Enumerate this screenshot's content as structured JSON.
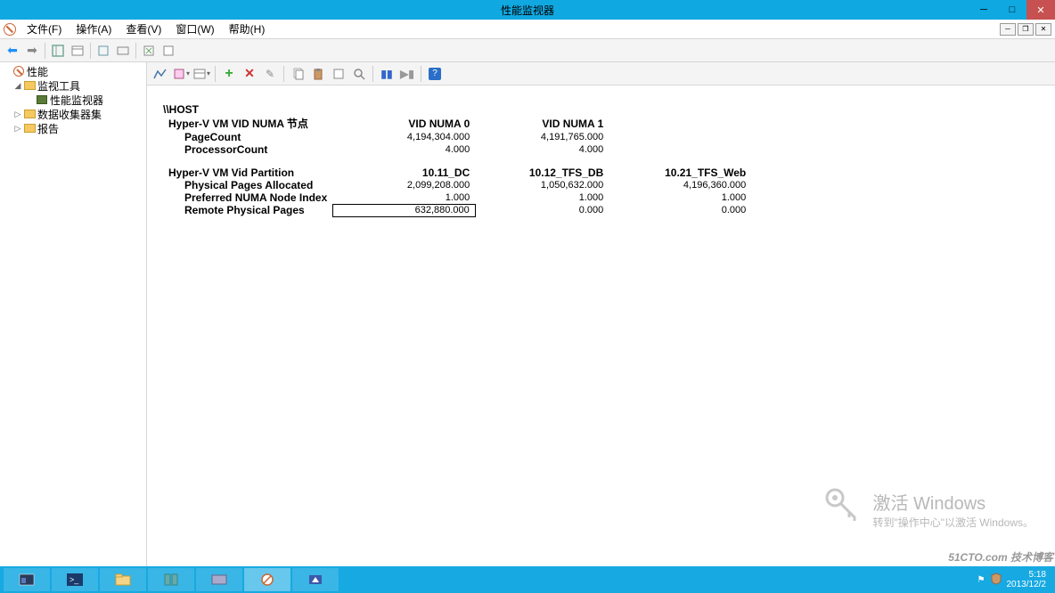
{
  "titlebar": {
    "title": "性能监视器"
  },
  "menus": {
    "file": "文件(F)",
    "action": "操作(A)",
    "view": "查看(V)",
    "window": "窗口(W)",
    "help": "帮助(H)"
  },
  "tree": {
    "root": "性能",
    "monitor_tools": "监视工具",
    "perf_monitor": "性能监视器",
    "collector_sets": "数据收集器集",
    "reports": "报告"
  },
  "report": {
    "host": "\\\\HOST",
    "group1": {
      "label": "Hyper-V VM VID NUMA 节点",
      "cols": [
        "VID NUMA 0",
        "VID NUMA 1"
      ],
      "rows": [
        {
          "label": "PageCount",
          "vals": [
            "4,194,304.000",
            "4,191,765.000"
          ]
        },
        {
          "label": "ProcessorCount",
          "vals": [
            "4.000",
            "4.000"
          ]
        }
      ]
    },
    "group2": {
      "label": "Hyper-V VM Vid Partition",
      "cols": [
        "10.11_DC",
        "10.12_TFS_DB",
        "10.21_TFS_Web"
      ],
      "rows": [
        {
          "label": "Physical Pages Allocated",
          "vals": [
            "2,099,208.000",
            "1,050,632.000",
            "4,196,360.000"
          ]
        },
        {
          "label": "Preferred NUMA Node Index",
          "vals": [
            "1.000",
            "1.000",
            "1.000"
          ]
        },
        {
          "label": "Remote Physical Pages",
          "vals": [
            "632,880.000",
            "0.000",
            "0.000"
          ],
          "highlight": 0
        }
      ]
    }
  },
  "watermark": {
    "title": "激活 Windows",
    "sub": "转到\"操作中心\"以激活 Windows。"
  },
  "corner": "51CTO.com 技术博客",
  "tray": {
    "time": "5:18",
    "date": "2013/12/2"
  }
}
